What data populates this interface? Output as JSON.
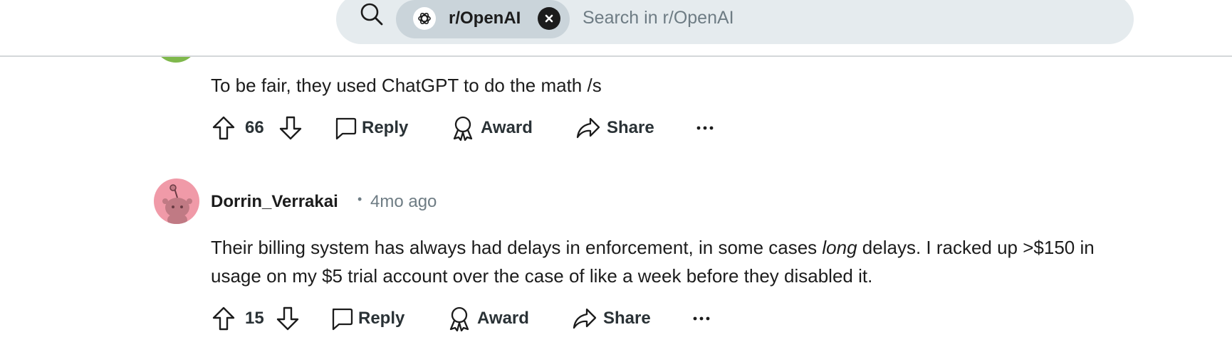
{
  "search": {
    "community_label": "r/OpenAI",
    "placeholder": "Search in r/OpenAI"
  },
  "comments": [
    {
      "text": "To be fair, they used ChatGPT to do the math /s",
      "votes": "66",
      "actions": {
        "reply": "Reply",
        "award": "Award",
        "share": "Share"
      }
    },
    {
      "author": "Dorrin_Verrakai",
      "separator": "•",
      "time": "4mo ago",
      "text_before": "Their billing system has always had delays in enforcement, in some cases ",
      "text_emphasis": "long",
      "text_after": " delays. I racked up >$150 in",
      "text_line2": "usage on my $5 trial account over the case of like a week before they disabled it.",
      "votes": "15",
      "actions": {
        "reply": "Reply",
        "award": "Award",
        "share": "Share"
      }
    }
  ],
  "colors": {
    "search_bg": "#e5ebee",
    "chip_bg": "#cad4da",
    "avatar_pink": "#f09aa8",
    "avatar_green": "#7fb84c",
    "muted_text": "#6e7c84"
  }
}
